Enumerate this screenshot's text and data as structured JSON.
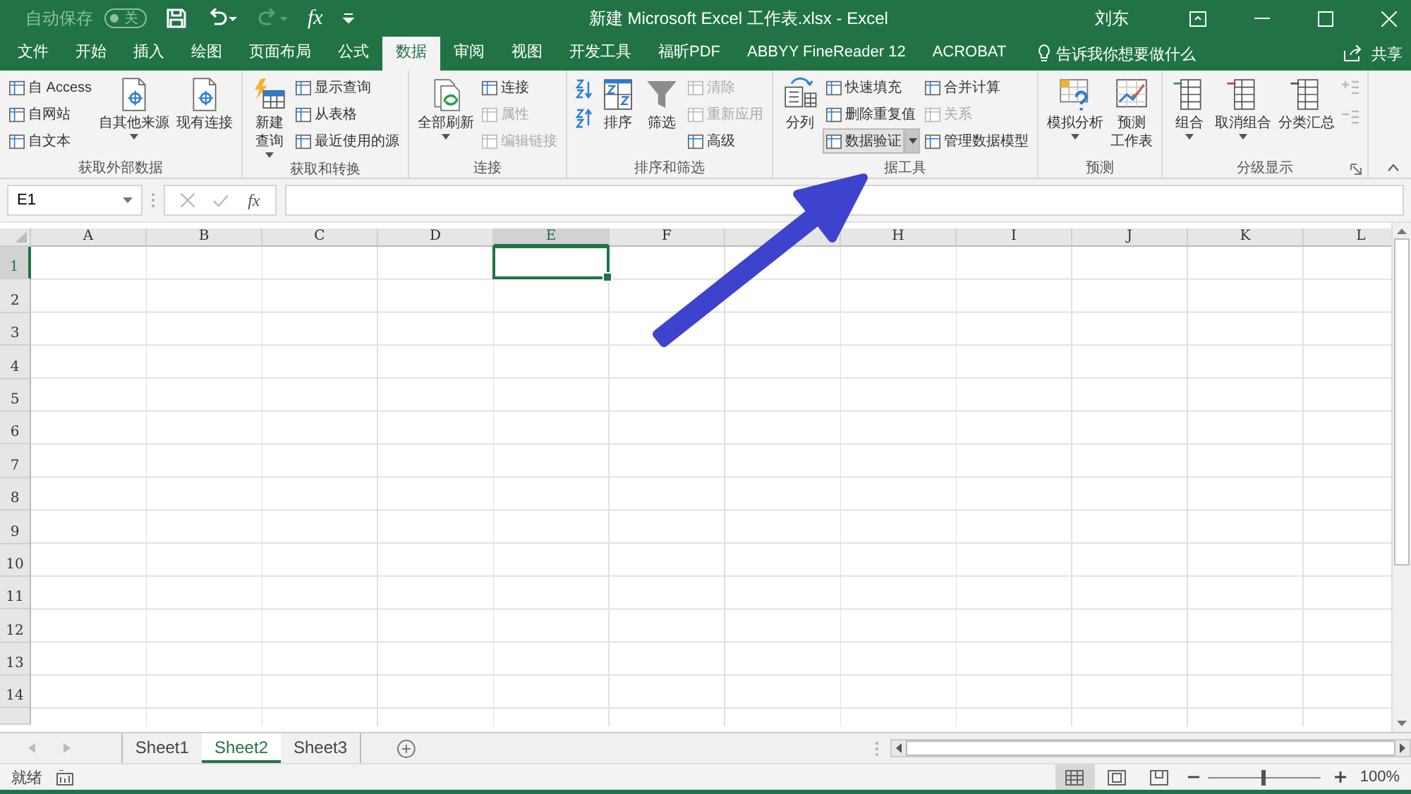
{
  "title_bar": {
    "autosave_label": "自动保存",
    "autosave": {
      "on": false,
      "label": "关"
    },
    "formula_icon": "fx",
    "title": "新建 Microsoft Excel 工作表.xlsx  -  Excel",
    "user": "刘东"
  },
  "tabs": [
    {
      "label": "文件",
      "selected": false
    },
    {
      "label": "开始",
      "selected": false
    },
    {
      "label": "插入",
      "selected": false
    },
    {
      "label": "绘图",
      "selected": false
    },
    {
      "label": "页面布局",
      "selected": false
    },
    {
      "label": "公式",
      "selected": false
    },
    {
      "label": "数据",
      "selected": true
    },
    {
      "label": "审阅",
      "selected": false
    },
    {
      "label": "视图",
      "selected": false
    },
    {
      "label": "开发工具",
      "selected": false
    },
    {
      "label": "福昕PDF",
      "selected": false
    },
    {
      "label": "ABBYY FineReader 12",
      "selected": false
    },
    {
      "label": "ACROBAT",
      "selected": false
    }
  ],
  "tell_me": "告诉我你想要做什么",
  "share": "共享",
  "ribbon_groups": [
    {
      "label": "获取外部数据",
      "items": [
        {
          "kind": "stack",
          "items": [
            {
              "label": "自 Access",
              "disabled": false
            },
            {
              "label": "自网站",
              "disabled": false
            },
            {
              "label": "自文本",
              "disabled": false
            }
          ]
        },
        {
          "kind": "large",
          "lines": [
            "自其他来源"
          ],
          "dropdown": true
        },
        {
          "kind": "large",
          "lines": [
            "现有连接"
          ],
          "dropdown": false
        }
      ]
    },
    {
      "label": "获取和转换",
      "items": [
        {
          "kind": "large",
          "lines": [
            "新建",
            "查询"
          ],
          "dropdown": true
        },
        {
          "kind": "stack",
          "items": [
            {
              "label": "显示查询",
              "disabled": false
            },
            {
              "label": "从表格",
              "disabled": false
            },
            {
              "label": "最近使用的源",
              "disabled": false
            }
          ]
        }
      ]
    },
    {
      "label": "连接",
      "items": [
        {
          "kind": "large",
          "lines": [
            "全部刷新"
          ],
          "dropdown": true
        },
        {
          "kind": "stack",
          "items": [
            {
              "label": "连接",
              "disabled": false
            },
            {
              "label": "属性",
              "disabled": true
            },
            {
              "label": "编辑链接",
              "disabled": true
            }
          ]
        }
      ]
    },
    {
      "label": "排序和筛选",
      "items": [
        {
          "kind": "icon_stack",
          "items": [
            {
              "disabled": false
            },
            {
              "disabled": false
            }
          ]
        },
        {
          "kind": "large",
          "lines": [
            "排序"
          ],
          "dropdown": false
        },
        {
          "kind": "large",
          "lines": [
            "筛选"
          ],
          "dropdown": false
        },
        {
          "kind": "stack",
          "items": [
            {
              "label": "清除",
              "disabled": true
            },
            {
              "label": "重新应用",
              "disabled": true
            },
            {
              "label": "高级",
              "disabled": false
            }
          ]
        }
      ]
    },
    {
      "label": "据工具",
      "items": [
        {
          "kind": "large",
          "lines": [
            "分列"
          ],
          "dropdown": false
        },
        {
          "kind": "stack",
          "items": [
            {
              "label": "快速填充",
              "disabled": false
            },
            {
              "label": "删除重复值",
              "disabled": false
            },
            {
              "label": "数据验证",
              "disabled": false,
              "dropdown": true,
              "highlighted": true
            }
          ]
        },
        {
          "kind": "stack",
          "items": [
            {
              "label": "合并计算",
              "disabled": false
            },
            {
              "label": "关系",
              "disabled": true
            },
            {
              "label": "管理数据模型",
              "disabled": false
            }
          ]
        }
      ]
    },
    {
      "label": "预测",
      "items": [
        {
          "kind": "large",
          "lines": [
            "模拟分析"
          ],
          "dropdown": true
        },
        {
          "kind": "large",
          "lines": [
            "预测",
            "工作表"
          ],
          "dropdown": false
        }
      ]
    },
    {
      "label": "分级显示",
      "launcher": true,
      "items": [
        {
          "kind": "large",
          "lines": [
            "组合"
          ],
          "dropdown": true
        },
        {
          "kind": "large",
          "lines": [
            "取消组合"
          ],
          "dropdown": true
        },
        {
          "kind": "large",
          "lines": [
            "分类汇总"
          ],
          "dropdown": false
        },
        {
          "kind": "icon_stack",
          "items": [
            {
              "disabled": true
            },
            {
              "disabled": true
            }
          ]
        }
      ]
    }
  ],
  "name_box": "E1",
  "function_button": "fx",
  "columns": [
    {
      "label": "A",
      "selected": false
    },
    {
      "label": "B",
      "selected": false
    },
    {
      "label": "C",
      "selected": false
    },
    {
      "label": "D",
      "selected": false
    },
    {
      "label": "E",
      "selected": true
    },
    {
      "label": "F",
      "selected": false
    },
    {
      "selected": false
    },
    {
      "label": "H",
      "selected": false
    },
    {
      "label": "I",
      "selected": false
    },
    {
      "label": "J",
      "selected": false
    },
    {
      "label": "K",
      "selected": false
    },
    {
      "label": "L",
      "selected": false
    }
  ],
  "rows": [
    {
      "label": "1",
      "selected": true
    },
    {
      "label": "2",
      "selected": false
    },
    {
      "label": "3",
      "selected": false
    },
    {
      "label": "4",
      "selected": false
    },
    {
      "label": "5",
      "selected": false
    },
    {
      "label": "6",
      "selected": false
    },
    {
      "label": "7",
      "selected": false
    },
    {
      "label": "8",
      "selected": false
    },
    {
      "label": "9",
      "selected": false
    },
    {
      "label": "10",
      "selected": false
    },
    {
      "label": "11",
      "selected": false
    },
    {
      "label": "12",
      "selected": false
    },
    {
      "label": "13",
      "selected": false
    },
    {
      "label": "14",
      "selected": false
    }
  ],
  "sheets": [
    {
      "label": "Sheet1",
      "selected": false
    },
    {
      "label": "Sheet2",
      "selected": true
    },
    {
      "label": "Sheet3",
      "selected": false
    }
  ],
  "status_bar": {
    "text": "就绪",
    "views": [
      {
        "selected": true
      },
      {
        "selected": false
      },
      {
        "selected": false
      }
    ],
    "zoom": {
      "level": 0.5,
      "label": "100%"
    }
  }
}
